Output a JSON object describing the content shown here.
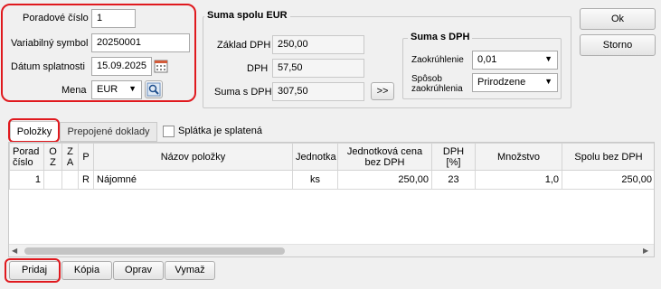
{
  "header": {
    "poradove_cislo_label": "Poradové číslo",
    "poradove_cislo_value": "1",
    "variabilny_symbol_label": "Variabilný symbol",
    "variabilny_symbol_value": "20250001",
    "datum_splatnosti_label": "Dátum splatnosti",
    "datum_splatnosti_value": "15.09.2025",
    "mena_label": "Mena",
    "mena_value": "EUR"
  },
  "suma_spolu": {
    "title": "Suma spolu EUR",
    "zaklad_label": "Základ DPH",
    "zaklad_value": "250,00",
    "dph_label": "DPH",
    "dph_value": "57,50",
    "suma_label": "Suma s DPH",
    "suma_value": "307,50",
    "expand_label": ">>"
  },
  "suma_s_dph": {
    "title": "Suma s DPH",
    "zaokruhlenie_label": "Zaokrúhlenie",
    "zaokruhlenie_value": "0,01",
    "sposob_label": "Spôsob zaokrúhlenia",
    "sposob_value": "Prirodzene"
  },
  "buttons": {
    "ok": "Ok",
    "storno": "Storno"
  },
  "tabs": {
    "polozky": "Položky",
    "prepojene": "Prepojené doklady",
    "splatka_checkbox": "Splátka je splatená"
  },
  "table": {
    "columns": [
      "Porad číslo",
      "O Z",
      "Z A",
      "P",
      "Názov položky",
      "Jednotka",
      "Jednotková cena bez DPH",
      "DPH [%]",
      "Množstvo",
      "Spolu bez DPH"
    ],
    "rows": [
      [
        "1",
        "",
        "",
        "R",
        "Nájomné",
        "ks",
        "250,00",
        "23",
        "1,0",
        "250,00"
      ]
    ]
  },
  "bottom_buttons": {
    "pridaj": "Pridaj",
    "kopia": "Kópia",
    "oprav": "Oprav",
    "vymaz": "Vymaž"
  },
  "colors": {
    "highlight": "#e0191e",
    "background": "#f0f0f0"
  }
}
